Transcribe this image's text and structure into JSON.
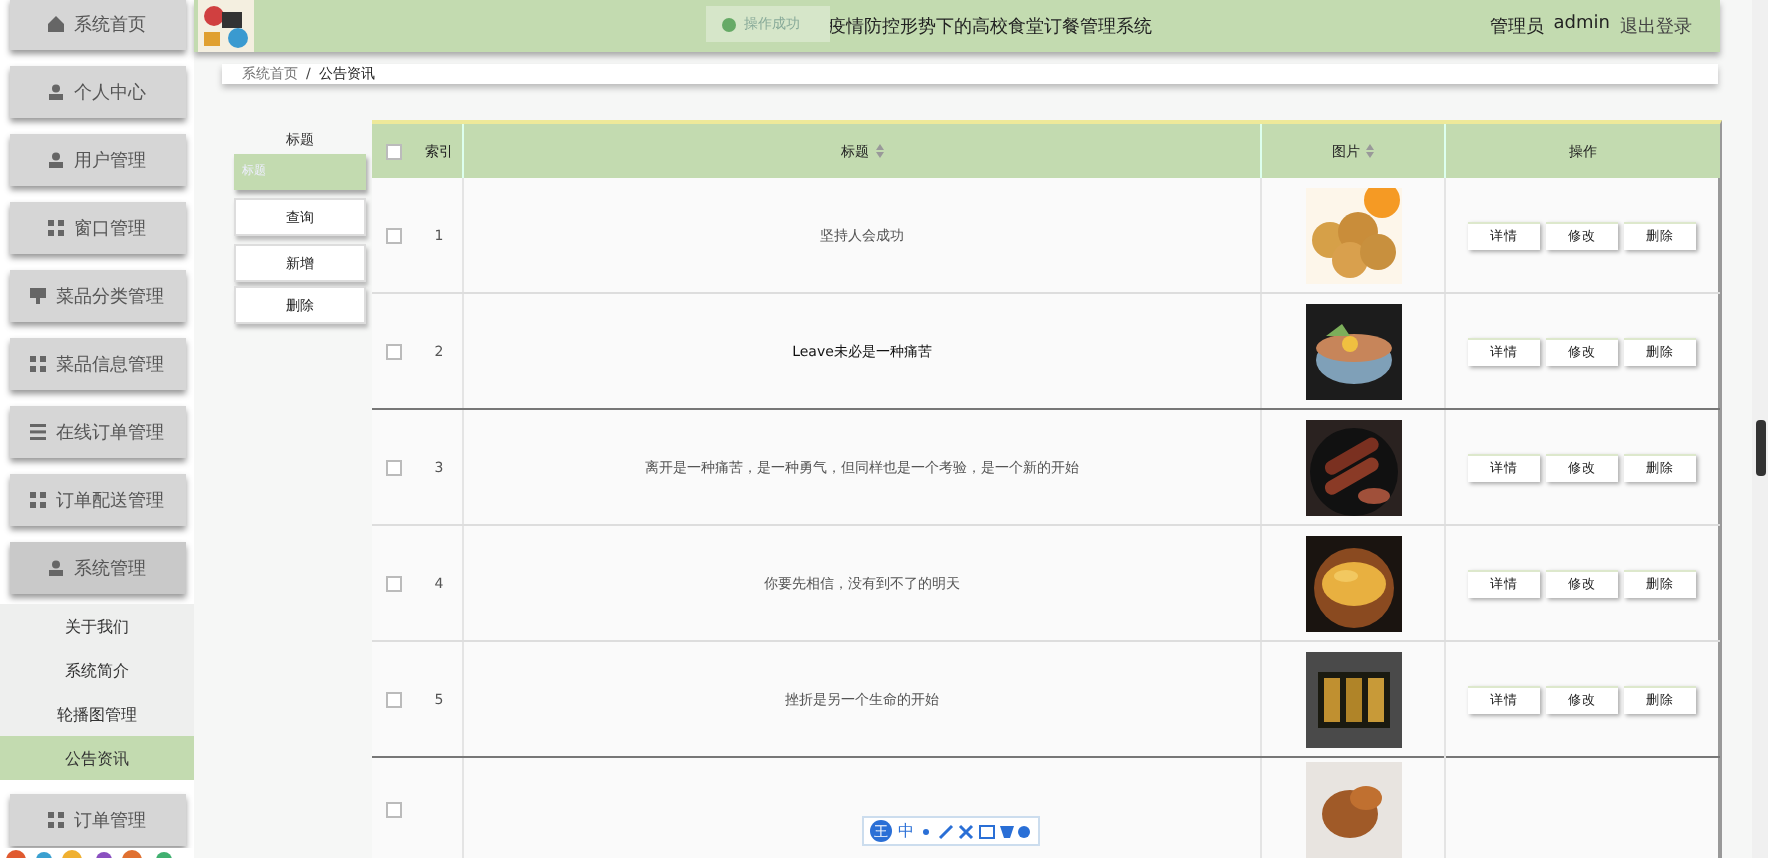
{
  "sidebar": {
    "items": [
      {
        "label": "系统首页",
        "expanded": false
      },
      {
        "label": "个人中心",
        "expanded": false
      },
      {
        "label": "用户管理",
        "expanded": false
      },
      {
        "label": "窗口管理",
        "expanded": false
      },
      {
        "label": "菜品分类管理",
        "expanded": false
      },
      {
        "label": "菜品信息管理",
        "expanded": false
      },
      {
        "label": "在线订单管理",
        "expanded": false
      },
      {
        "label": "订单配送管理",
        "expanded": false
      },
      {
        "label": "系统管理",
        "expanded": true,
        "children": [
          {
            "label": "关于我们",
            "selected": false
          },
          {
            "label": "系统简介",
            "selected": false
          },
          {
            "label": "轮播图管理",
            "selected": false
          },
          {
            "label": "公告资讯",
            "selected": true
          }
        ]
      },
      {
        "label": "订单管理",
        "expanded": false
      }
    ]
  },
  "header": {
    "title": "疫情防控形势下的高校食堂订餐管理系统",
    "role": "管理员",
    "user": "admin",
    "logout": "退出登录",
    "toast": "操作成功"
  },
  "breadcrumb": {
    "items": [
      "系统首页",
      "公告资讯"
    ],
    "separator": "/"
  },
  "search": {
    "label": "标题",
    "placeholder": "标题",
    "buttons": [
      "查询",
      "新增",
      "删除"
    ]
  },
  "table": {
    "columns": [
      "索引",
      "标题",
      "图片",
      "操作"
    ],
    "all_checked": false,
    "rows": [
      {
        "checked": false,
        "index": "1",
        "title": "坚持人会成功",
        "actions": [
          "详情",
          "修改",
          "删除"
        ]
      },
      {
        "checked": false,
        "index": "2",
        "title": "Leave未必是一种痛苦",
        "actions": [
          "详情",
          "修改",
          "删除"
        ]
      },
      {
        "checked": false,
        "index": "3",
        "title": "离开是一种痛苦，是一种勇气，但同样也是一个考验，是一个新的开始",
        "actions": [
          "详情",
          "修改",
          "删除"
        ]
      },
      {
        "checked": false,
        "index": "4",
        "title": "你要先相信，没有到不了的明天",
        "actions": [
          "详情",
          "修改",
          "删除"
        ]
      },
      {
        "checked": false,
        "index": "5",
        "title": "挫折是另一个生命的开始",
        "actions": [
          "详情",
          "修改",
          "删除"
        ]
      },
      {
        "checked": false
      }
    ]
  },
  "ime_toolbar": {
    "badge": "王",
    "mode": "中"
  }
}
